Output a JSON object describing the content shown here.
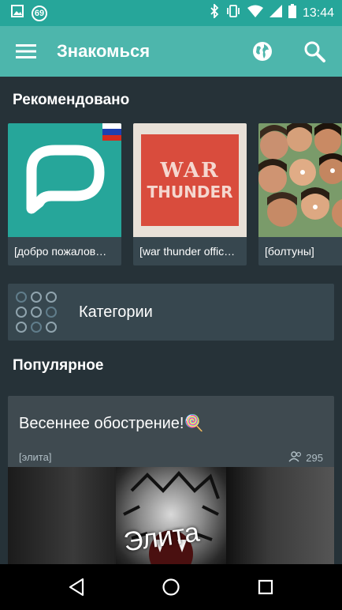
{
  "status_bar": {
    "notification_badge": "69",
    "time": "13:44",
    "icons": [
      "image-icon",
      "bluetooth-icon",
      "vibrate-icon",
      "wifi-icon",
      "signal-icon",
      "battery-icon"
    ]
  },
  "app_bar": {
    "title": "Знакомься",
    "icons": [
      "menu-icon",
      "globe-icon",
      "search-icon"
    ]
  },
  "recommended": {
    "title": "Рекомендовано",
    "items": [
      {
        "label": "[добро пожалов…",
        "thumb": "palringo-logo",
        "flag": "russia"
      },
      {
        "label": "[war thunder offic…",
        "thumb": "war-thunder-logo",
        "thumb_text": [
          "WAR",
          "THUNDER"
        ]
      },
      {
        "label": "[болтуны]",
        "thumb": "group-photo"
      }
    ]
  },
  "categories": {
    "label": "Категории"
  },
  "popular": {
    "title": "Популярное",
    "card": {
      "title": "Весеннее обострение!🍭",
      "tag": "[элита]",
      "member_count": "295",
      "image_text": "Элита"
    }
  },
  "nav_bar": {
    "icons": [
      "back-icon",
      "home-icon",
      "recents-icon"
    ]
  },
  "colors": {
    "status_bar": "#26A69A",
    "app_bar": "#4DB6AC",
    "background": "#263238",
    "card": "#37474F",
    "accent_red": "#D32F2F"
  }
}
